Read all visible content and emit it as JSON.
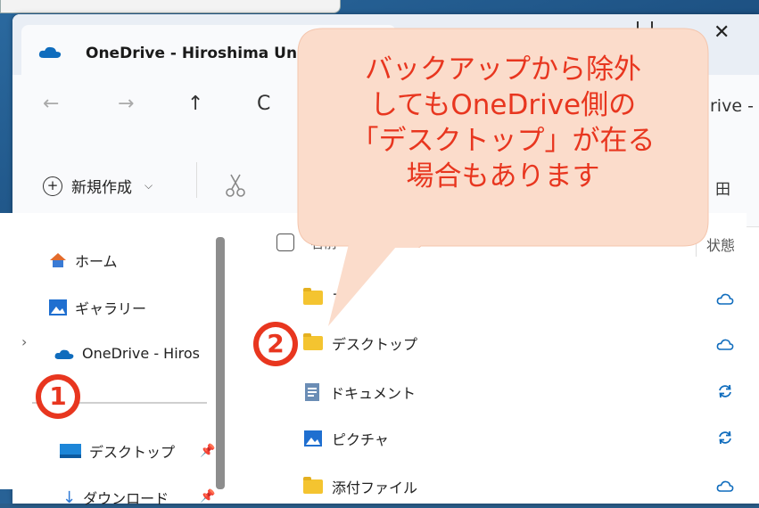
{
  "window": {
    "tab_title": "OneDrive - Hiroshima Unive",
    "close_glyph": "✕",
    "address_tail": "rive -"
  },
  "nav": {
    "back": "←",
    "forward": "→",
    "up": "↑",
    "refresh": "C"
  },
  "toolbar": {
    "new_label": "新規作成",
    "new_chevron": "⌵",
    "right_glyph": "田"
  },
  "sidebar": {
    "items": [
      {
        "label": "ホーム",
        "icon": "home-icon"
      },
      {
        "label": "ギャラリー",
        "icon": "gallery-icon"
      },
      {
        "label": "OneDrive - Hiros",
        "icon": "onedrive-cloud-icon"
      },
      {
        "label": "デスクトップ",
        "icon": "desktop-icon"
      },
      {
        "label": "ダウンロード",
        "icon": "download-icon"
      }
    ],
    "expand_glyph": "›",
    "pin_glyph": "📌"
  },
  "list": {
    "header_name": "名前",
    "header_status": "状態",
    "rows": [
      {
        "name": "ア",
        "icon": "folder-icon",
        "status": "cloud-icon"
      },
      {
        "name": "デスクトップ",
        "icon": "folder-icon",
        "status": "cloud-icon"
      },
      {
        "name": "ドキュメント",
        "icon": "document-icon",
        "status": "sync-icon"
      },
      {
        "name": "ピクチャ",
        "icon": "pictures-icon",
        "status": "sync-icon"
      },
      {
        "name": "添付ファイル",
        "icon": "folder-icon",
        "status": "cloud-icon"
      }
    ]
  },
  "callout": {
    "lines": [
      "バックアップから除外",
      "してもOneDrive側の",
      "「デスクトップ」が在る",
      "場合もあります"
    ]
  },
  "badges": {
    "one": "1",
    "two": "2"
  },
  "colors": {
    "accent_red": "#e8361f",
    "callout_fill": "#fbdccb",
    "folder_yellow": "#f4c430",
    "onedrive_blue": "#0f6cbd"
  }
}
